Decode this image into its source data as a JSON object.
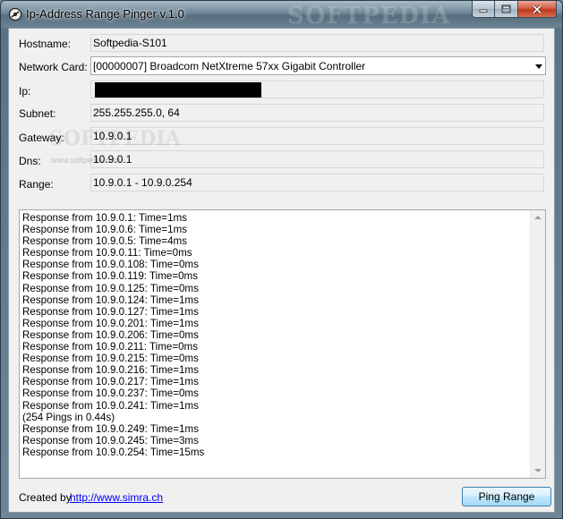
{
  "window": {
    "title": "Ip-Address Range Pinger v.1.0",
    "watermark": "SOFTPEDIA"
  },
  "form": {
    "hostname": {
      "label": "Hostname:",
      "value": "Softpedia-S101"
    },
    "network_card": {
      "label": "Network Card:",
      "value": "[00000007] Broadcom NetXtreme 57xx Gigabit Controller"
    },
    "ip": {
      "label": "Ip:",
      "value": ""
    },
    "subnet": {
      "label": "Subnet:",
      "value": "255.255.255.0, 64"
    },
    "gateway": {
      "label": "Gateway:",
      "value": "10.9.0.1"
    },
    "dns": {
      "label": "Dns:",
      "value": "10.9.0.1"
    },
    "range": {
      "label": "Range:",
      "value": "10.9.0.1 - 10.9.0.254"
    }
  },
  "watermarks": {
    "inline": "SOFTPEDIA",
    "small": "www.softpedia.com"
  },
  "output": {
    "lines": [
      "Response from 10.9.0.1: Time=1ms",
      "Response from 10.9.0.6: Time=1ms",
      "Response from 10.9.0.5: Time=4ms",
      "Response from 10.9.0.11: Time=0ms",
      "Response from 10.9.0.108: Time=0ms",
      "Response from 10.9.0.119: Time=0ms",
      "Response from 10.9.0.125: Time=0ms",
      "Response from 10.9.0.124: Time=1ms",
      "Response from 10.9.0.127: Time=1ms",
      "Response from 10.9.0.201: Time=1ms",
      "Response from 10.9.0.206: Time=0ms",
      "Response from 10.9.0.211: Time=0ms",
      "Response from 10.9.0.215: Time=0ms",
      "Response from 10.9.0.216: Time=1ms",
      "Response from 10.9.0.217: Time=1ms",
      "Response from 10.9.0.237: Time=0ms",
      "Response from 10.9.0.241: Time=1ms",
      "(254 Pings in 0.44s)",
      "Response from 10.9.0.249: Time=1ms",
      "Response from 10.9.0.245: Time=3ms",
      "Response from 10.9.0.254: Time=15ms"
    ]
  },
  "footer": {
    "created_by": "Created by",
    "link": "http://www.simra.ch",
    "ping_button": "Ping Range"
  },
  "colors": {
    "link": "#0000ff",
    "window_frame": "#6d8190",
    "close_button": "#c0391f"
  }
}
